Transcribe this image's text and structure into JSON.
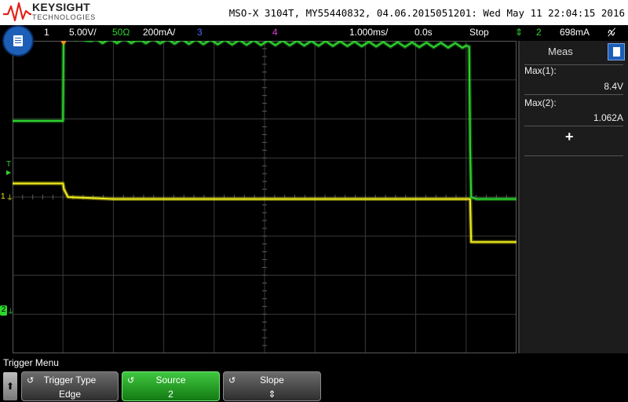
{
  "header": {
    "brand_name": "KEYSIGHT",
    "brand_sub": "TECHNOLOGIES",
    "instrument_info": "MSO-X 3104T, MY55440832, 04.06.2015051201: Wed May 11 22:04:15 2016"
  },
  "status": {
    "ch1_num": "1",
    "ch1_scale": "5.00V/",
    "ch2_impedance": "50Ω",
    "ch2_scale": "200mA/",
    "ch3_num": "3",
    "ch4_num": "4",
    "timebase": "1.000ms/",
    "delay": "0.0s",
    "run_state": "Stop",
    "trigger_icon": "⇕",
    "trigger_source": "2",
    "trigger_level": "698mA"
  },
  "markers": {
    "trigger": "T",
    "ch1": "1",
    "ch2": "2"
  },
  "measurements": {
    "title": "Meas",
    "items": [
      {
        "label": "Max(1):",
        "value": "8.4V"
      },
      {
        "label": "Max(2):",
        "value": "1.062A"
      }
    ],
    "add_symbol": "+"
  },
  "softkeys": {
    "menu_title": "Trigger Menu",
    "up_arrow": "🠅",
    "keys": [
      {
        "title": "Trigger Type",
        "value": "Edge"
      },
      {
        "title": "Source",
        "value": "2"
      },
      {
        "title": "Slope",
        "value": "⇕"
      }
    ]
  },
  "colors": {
    "ch1": "#f2ef1b",
    "ch2": "#2fd62f",
    "ch3": "#4a6cff",
    "ch4": "#e23ad0",
    "menu_blue": "#1d5fb7"
  },
  "chart_data": {
    "type": "line",
    "series": [
      {
        "channel": "1",
        "x": [
          -5.0,
          -4.0,
          -3.98,
          -3.9,
          -3.0,
          0.0,
          2.0,
          4.08,
          4.1,
          4.4,
          5.0
        ],
        "y": [
          0.35,
          0.35,
          0.2,
          0.0,
          -0.05,
          -0.05,
          -0.05,
          -0.05,
          -1.15,
          -1.15,
          -1.15
        ]
      },
      {
        "channel": "2",
        "x": [
          -5.0,
          -4.0,
          -3.98,
          -3.95,
          -3.8,
          -3.5,
          -2.5,
          0.0,
          2.0,
          4.0,
          4.06,
          4.08,
          4.1,
          4.2,
          5.0
        ],
        "y": [
          1.95,
          1.95,
          5.4,
          4.3,
          4.05,
          4.0,
          4.0,
          3.95,
          3.92,
          3.88,
          3.85,
          1.3,
          0.0,
          -0.05,
          -0.05
        ]
      }
    ]
  }
}
